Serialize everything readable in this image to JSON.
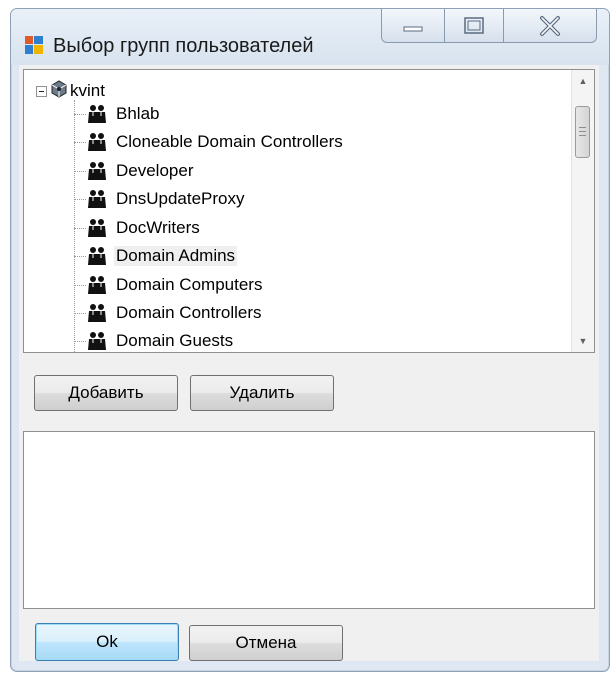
{
  "window": {
    "title": "Выбор групп пользователей",
    "controls": {
      "minimize": "minimize-icon",
      "maximize": "maximize-icon",
      "close": "close-icon"
    }
  },
  "tree": {
    "root": {
      "label": "kvint",
      "expanded": true,
      "icon": "domain-icon"
    },
    "items": [
      {
        "label": "Bhlab",
        "icon": "user-group-icon"
      },
      {
        "label": "Cloneable Domain Controllers",
        "icon": "user-group-icon"
      },
      {
        "label": "Developer",
        "icon": "user-group-icon"
      },
      {
        "label": "DnsUpdateProxy",
        "icon": "user-group-icon"
      },
      {
        "label": "DocWriters",
        "icon": "user-group-icon"
      },
      {
        "label": "Domain Admins",
        "icon": "user-group-icon",
        "selected": true
      },
      {
        "label": "Domain Computers",
        "icon": "user-group-icon"
      },
      {
        "label": "Domain Controllers",
        "icon": "user-group-icon"
      },
      {
        "label": "Domain Guests",
        "icon": "user-group-icon"
      }
    ]
  },
  "buttons": {
    "add": "Добавить",
    "remove": "Удалить",
    "ok": "Ok",
    "cancel": "Отмена"
  },
  "selected_list": {
    "items": []
  },
  "colors": {
    "frame": "#dfe8f2",
    "client": "#f0f0f0",
    "ok_button_accent": "#3c7fb1"
  }
}
